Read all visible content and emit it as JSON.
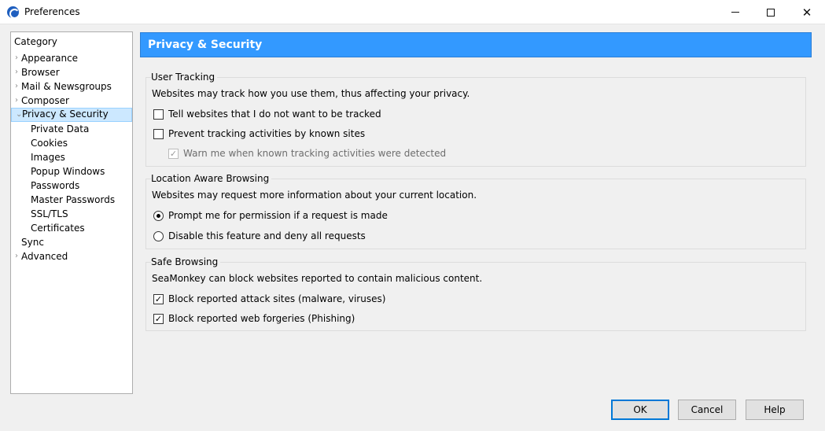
{
  "window": {
    "title": "Preferences",
    "icon": "seamonkey-app-icon"
  },
  "tree": {
    "header": "Category",
    "items": [
      {
        "label": "Appearance",
        "twisty": "›"
      },
      {
        "label": "Browser",
        "twisty": "›"
      },
      {
        "label": "Mail & Newsgroups",
        "twisty": "›"
      },
      {
        "label": "Composer",
        "twisty": "›"
      },
      {
        "label": "Privacy & Security",
        "twisty": "⌄",
        "selected": true
      },
      {
        "label": "Private Data"
      },
      {
        "label": "Cookies"
      },
      {
        "label": "Images"
      },
      {
        "label": "Popup Windows"
      },
      {
        "label": "Passwords"
      },
      {
        "label": "Master Passwords"
      },
      {
        "label": "SSL/TLS"
      },
      {
        "label": "Certificates"
      },
      {
        "label": "Sync"
      },
      {
        "label": "Advanced",
        "twisty": "›"
      }
    ]
  },
  "panel": {
    "title": "Privacy & Security",
    "accent_color": "#3399ff",
    "user_tracking": {
      "caption": "User Tracking",
      "description": "Websites may track how you use them, thus affecting your privacy.",
      "opt1": "Tell websites that I do not want to be tracked",
      "opt2": "Prevent tracking activities by known sites",
      "opt3": "Warn me when known tracking activities were detected",
      "check_mark": "✓"
    },
    "location": {
      "caption": "Location Aware Browsing",
      "description": "Websites may request more information about your current location.",
      "opt1": "Prompt me for permission if a request is made",
      "opt2": "Disable this feature and deny all requests"
    },
    "safe_browsing": {
      "caption": "Safe Browsing",
      "description": "SeaMonkey can block websites reported to contain malicious content.",
      "opt1": "Block reported attack sites (malware, viruses)",
      "opt2": "Block reported web forgeries (Phishing)",
      "check_mark": "✓"
    }
  },
  "buttons": {
    "ok": "OK",
    "cancel": "Cancel",
    "help": "Help"
  },
  "window_controls": {
    "close": "✕"
  }
}
